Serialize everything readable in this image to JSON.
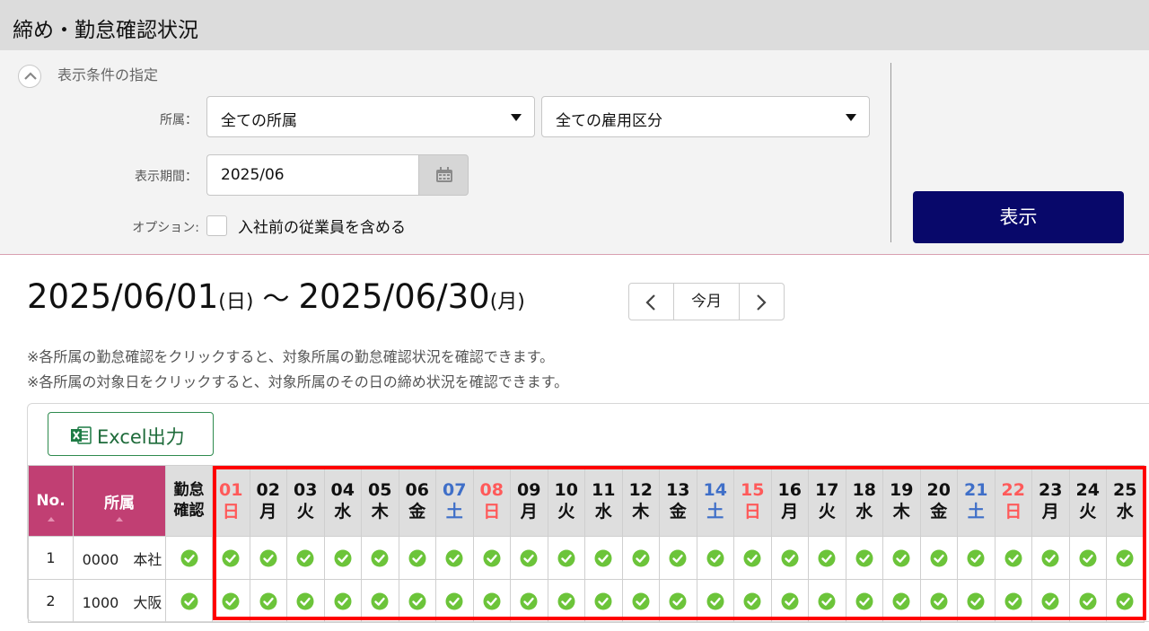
{
  "page": {
    "title": "締め・勤怠確認状況"
  },
  "filter": {
    "section_title": "表示条件の指定",
    "dept_label": "所属：",
    "dept_value": "全ての所属",
    "employment_value": "全ての雇用区分",
    "period_label": "表示期間：",
    "period_value": "2025/06",
    "option_label": "オプション:",
    "option_checkbox_label": "入社前の従業員を含める",
    "option_checked": false,
    "show_button": "表示",
    "icons": {
      "collapse": "chevron-up-icon",
      "calendar": "calendar-icon",
      "dropdown": "caret-down-icon"
    }
  },
  "range": {
    "start": "2025/06/01",
    "start_weekday": "(日)",
    "tilde": "～",
    "end": "2025/06/30",
    "end_weekday": "(月)"
  },
  "nav": {
    "today": "今月",
    "icons": {
      "prev": "chevron-left-icon",
      "next": "chevron-right-icon"
    }
  },
  "notes": [
    "※各所属の勤怠確認をクリックすると、対象所属の勤怠確認状況を確認できます。",
    "※各所属の対象日をクリックすると、対象所属のその日の締め状況を確認できます。"
  ],
  "table": {
    "excel_button": "Excel出力",
    "col_no": "No.",
    "col_dept": "所属",
    "col_kintai": [
      "勤怠",
      "確認"
    ],
    "days": [
      {
        "d": "01",
        "w": "日",
        "t": "sun"
      },
      {
        "d": "02",
        "w": "月",
        "t": ""
      },
      {
        "d": "03",
        "w": "火",
        "t": ""
      },
      {
        "d": "04",
        "w": "水",
        "t": ""
      },
      {
        "d": "05",
        "w": "木",
        "t": ""
      },
      {
        "d": "06",
        "w": "金",
        "t": ""
      },
      {
        "d": "07",
        "w": "土",
        "t": "sat"
      },
      {
        "d": "08",
        "w": "日",
        "t": "sun"
      },
      {
        "d": "09",
        "w": "月",
        "t": ""
      },
      {
        "d": "10",
        "w": "火",
        "t": ""
      },
      {
        "d": "11",
        "w": "水",
        "t": ""
      },
      {
        "d": "12",
        "w": "木",
        "t": ""
      },
      {
        "d": "13",
        "w": "金",
        "t": ""
      },
      {
        "d": "14",
        "w": "土",
        "t": "sat"
      },
      {
        "d": "15",
        "w": "日",
        "t": "sun"
      },
      {
        "d": "16",
        "w": "月",
        "t": ""
      },
      {
        "d": "17",
        "w": "火",
        "t": ""
      },
      {
        "d": "18",
        "w": "水",
        "t": ""
      },
      {
        "d": "19",
        "w": "木",
        "t": ""
      },
      {
        "d": "20",
        "w": "金",
        "t": ""
      },
      {
        "d": "21",
        "w": "土",
        "t": "sat"
      },
      {
        "d": "22",
        "w": "日",
        "t": "sun"
      },
      {
        "d": "23",
        "w": "月",
        "t": ""
      },
      {
        "d": "24",
        "w": "火",
        "t": ""
      },
      {
        "d": "25",
        "w": "水",
        "t": ""
      }
    ],
    "rows": [
      {
        "no": "1",
        "dept": "0000　本社",
        "kintai": "ok",
        "status": "ok"
      },
      {
        "no": "2",
        "dept": "1000　大阪",
        "kintai": "ok",
        "status": "ok"
      }
    ],
    "status_icon": "check-circle-icon"
  },
  "colors": {
    "header_magenta": "#c13f73",
    "primary_button": "#08086a",
    "check_green": "#6cc43a",
    "sunday": "#ff5a5a",
    "saturday": "#3f6fc8",
    "highlight": "#ff0000"
  }
}
